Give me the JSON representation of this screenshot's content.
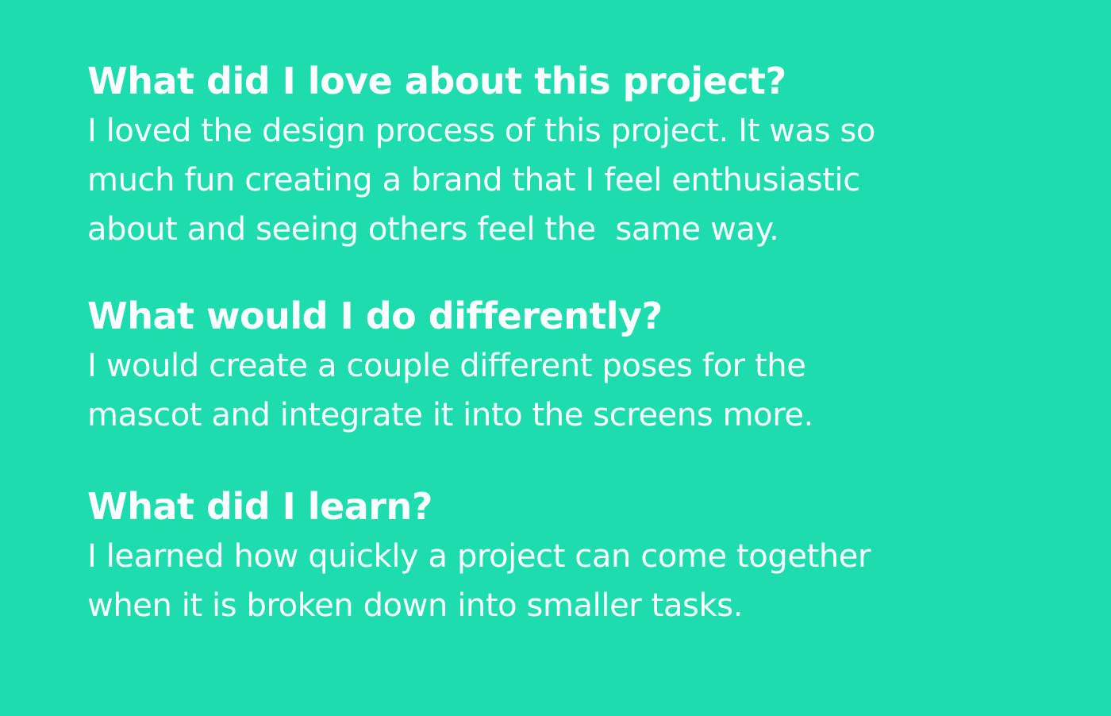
{
  "background_color": "#1ddcae",
  "text_color": "#ffffff",
  "sections": [
    {
      "heading": "What did I love about this project?",
      "lines": [
        "I loved the design process of this project. It was so",
        "much fun creating a brand that I feel enthusiastic",
        "about and seeing others feel the  same way."
      ]
    },
    {
      "heading": "What would I do differently?",
      "lines": [
        "I would create a couple different poses for the",
        "mascot and integrate it into the screens more."
      ]
    },
    {
      "heading": "What did I learn?",
      "lines": [
        "I learned how quickly a project can come together",
        "when it is broken down into smaller tasks."
      ]
    }
  ]
}
